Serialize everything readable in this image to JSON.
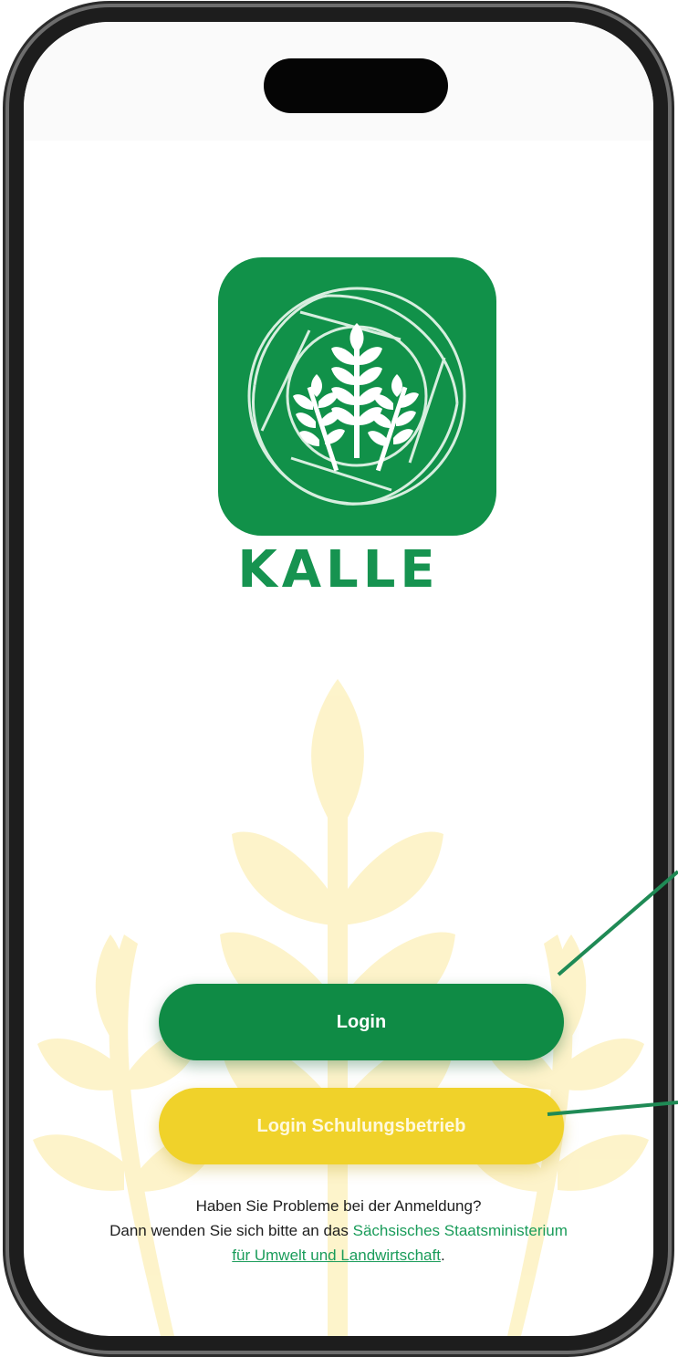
{
  "app": {
    "name": "KALLE"
  },
  "logo": {
    "icon": "wheat-shutter-logo",
    "background_color": "#119149"
  },
  "actions": {
    "login_label": "Login",
    "training_login_label": "Login Schulungsbetrieb"
  },
  "help": {
    "line1": "Haben Sie Probleme bei der Anmeldung?",
    "line2_prefix": "Dann wenden Sie sich bitte an das ",
    "ministry_link_part1": "Sächsisches Staatsministerium",
    "ministry_link_part2": "für Umwelt und Landwirtschaft",
    "line3_suffix": "."
  },
  "colors": {
    "primary_green": "#0f8b45",
    "accent_yellow": "#f0d22a",
    "link_green": "#1a9c5a",
    "background_wheat": "#fdf4cf"
  }
}
